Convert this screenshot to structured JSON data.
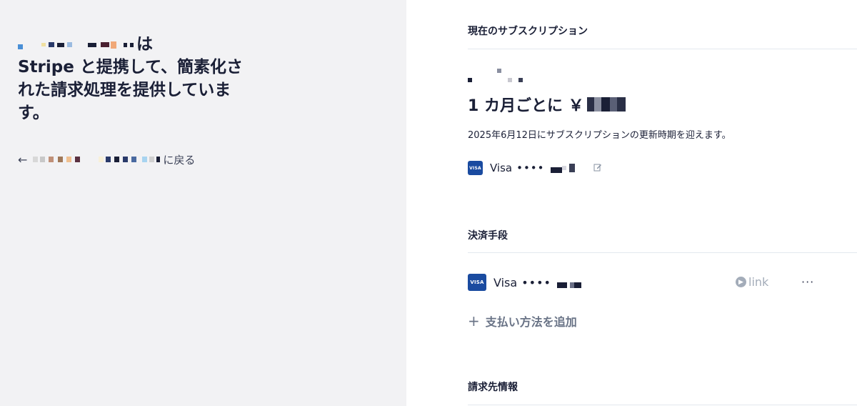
{
  "left": {
    "headline_suffix": "は",
    "headline_line2": "Stripe と提携して、簡素化さ",
    "headline_line3": "れた請求処理を提供していま",
    "headline_line4": "す。",
    "back_arrow": "←",
    "back_suffix": "に戻る"
  },
  "subscription": {
    "section_title": "現在のサブスクリプション",
    "price_prefix": "1 カ月ごとに ￥",
    "renewal_text": "2025年6月12日にサブスクリプションの更新時期を迎えます。",
    "card_brand": "Visa",
    "card_dots": "••••",
    "edit_icon": "edit-icon"
  },
  "payment_methods": {
    "section_title": "決済手段",
    "card_brand": "Visa",
    "card_badge_text": "VISA",
    "card_dots": "••••",
    "link_label": "link",
    "more_label": "···",
    "add_label": "支払い方法を追加",
    "add_icon": "plus-icon"
  },
  "billing": {
    "section_title": "請求先情報"
  },
  "colors": {
    "left_bg": "#f2f2f4",
    "visa_blue": "#1a4ba0",
    "text_dark": "#1a1f36",
    "muted": "#a3acb9"
  }
}
